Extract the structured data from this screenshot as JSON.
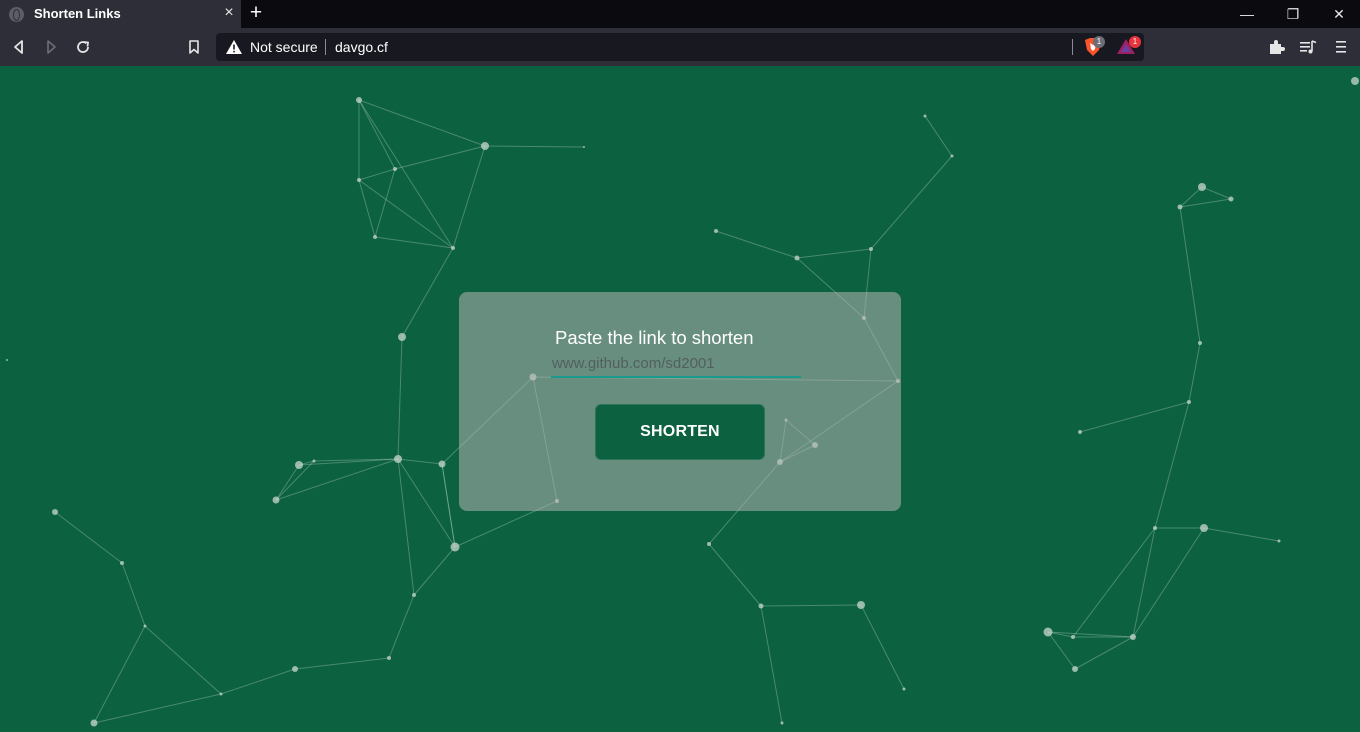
{
  "browser": {
    "tab": {
      "title": "Shorten Links",
      "close_icon": "close-icon"
    },
    "new_tab_label": "+",
    "window_controls": {
      "minimize": "—",
      "restore": "❐",
      "close": "✕"
    },
    "address_bar": {
      "security_label": "Not secure",
      "url": "davgo.cf",
      "shields_badge": "1",
      "rewards_badge": "1"
    },
    "colors": {
      "tab_active": "#2d2e38",
      "tabbar": "#0a0a0f",
      "urlbar": "#181920"
    }
  },
  "page": {
    "background_color": "#0c6140",
    "card": {
      "title": "Paste the link to shorten",
      "input": {
        "placeholder": "www.github.com/sd2001",
        "value": ""
      },
      "button_label": "SHORTEN"
    }
  }
}
